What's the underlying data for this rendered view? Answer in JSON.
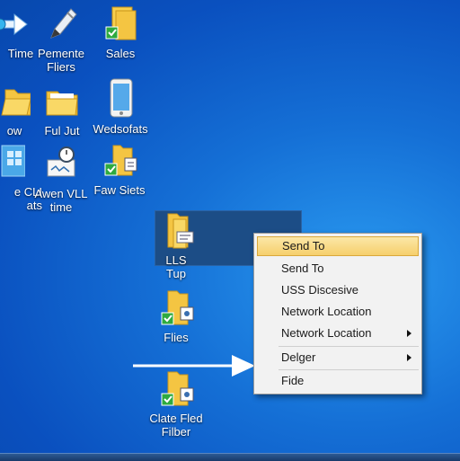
{
  "desktop": {
    "icons": [
      {
        "name": "icon-time",
        "label": "Time",
        "glyph": "arrow-icon"
      },
      {
        "name": "icon-pemente-fliers",
        "label": "Pemente\nFliers",
        "glyph": "pen-icon"
      },
      {
        "name": "icon-sales",
        "label": "Sales",
        "glyph": "folder-check-icon"
      },
      {
        "name": "icon-ow",
        "label": "ow",
        "glyph": "folder-icon"
      },
      {
        "name": "icon-ful-jut",
        "label": "Ful Jut",
        "glyph": "folder-icon"
      },
      {
        "name": "icon-wedsofats",
        "label": "Wedsofats",
        "glyph": "phone-icon"
      },
      {
        "name": "icon-cli",
        "label": "e CLI\nats",
        "glyph": "windows-icon"
      },
      {
        "name": "icon-awen-vll",
        "label": "Awen VLL\ntime",
        "glyph": "clock-icon"
      },
      {
        "name": "icon-faw-siets",
        "label": "Faw Siets",
        "glyph": "folder-check-icon"
      },
      {
        "name": "icon-lls-tup",
        "label": "LLS\nTup",
        "glyph": "folder-doc-icon"
      },
      {
        "name": "icon-flies",
        "label": "Flies",
        "glyph": "folder-check-icon"
      },
      {
        "name": "icon-clate-fled-filber",
        "label": "Clate Fled\nFilber",
        "glyph": "folder-check-icon"
      }
    ]
  },
  "context_menu": {
    "items": [
      {
        "label": "Send To",
        "highlighted": true,
        "submenu": false
      },
      {
        "label": "Send To",
        "highlighted": false,
        "submenu": false
      },
      {
        "label": "USS Discesive",
        "highlighted": false,
        "submenu": false
      },
      {
        "label": "Network Location",
        "highlighted": false,
        "submenu": false
      },
      {
        "label": "Network Location",
        "highlighted": false,
        "submenu": true
      },
      {
        "label": "Delger",
        "highlighted": false,
        "submenu": true
      },
      {
        "label": "Fide",
        "highlighted": false,
        "submenu": false
      }
    ]
  },
  "colors": {
    "desktop_bg": "#1570d6",
    "menu_highlight": "#f6cf6c",
    "folder": "#f4c542",
    "check": "#2eaa3f"
  }
}
